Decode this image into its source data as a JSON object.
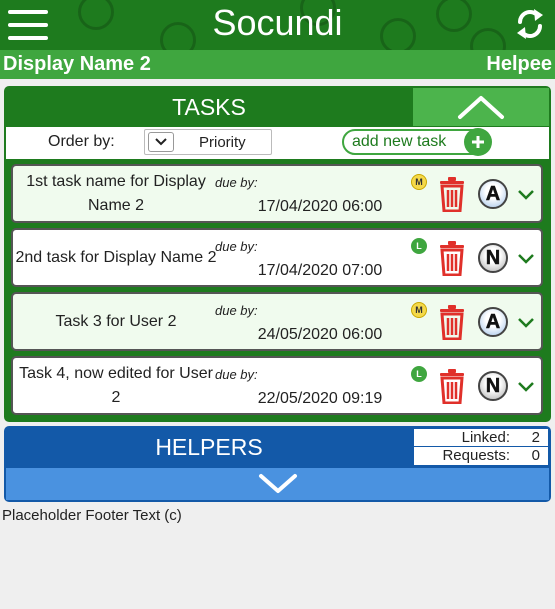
{
  "header": {
    "title": "Socundi",
    "menu_icon": "hamburger-menu-icon",
    "refresh_icon": "refresh-icon"
  },
  "subheader": {
    "display_name": "Display Name 2",
    "role": "Helpee"
  },
  "tasks": {
    "title": "TASKS",
    "order_by_label": "Order by:",
    "order_by_value": "Priority",
    "add_task_label": "add new task",
    "items": [
      {
        "name": "1st task name for Display Name 2",
        "due_label": "due by:",
        "due": "17/04/2020 06:00",
        "priority": "M",
        "status": "A"
      },
      {
        "name": "2nd task for Display Name 2",
        "due_label": "due by:",
        "due": "17/04/2020 07:00",
        "priority": "L",
        "status": "N"
      },
      {
        "name": "Task 3 for User 2",
        "due_label": "due by:",
        "due": "24/05/2020 06:00",
        "priority": "M",
        "status": "A"
      },
      {
        "name": "Task 4, now edited for User 2",
        "due_label": "due by:",
        "due": "22/05/2020 09:19",
        "priority": "L",
        "status": "N"
      }
    ]
  },
  "helpers": {
    "title": "HELPERS",
    "linked_label": "Linked:",
    "linked_value": "2",
    "requests_label": "Requests:",
    "requests_value": "0"
  },
  "footer": {
    "text": "Placeholder Footer Text (c)"
  },
  "colors": {
    "header_green": "#1e7b1e",
    "subheader_green": "#3fa63f",
    "helpers_blue": "#1359a8",
    "delete_red": "#e0302a"
  }
}
